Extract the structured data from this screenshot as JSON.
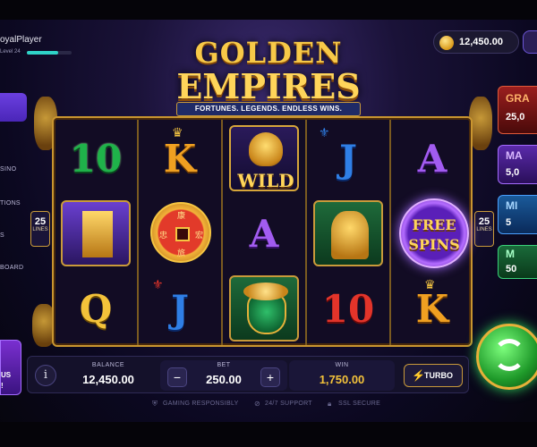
{
  "player": {
    "name": "oyalPlayer",
    "level": "Level 24",
    "xp_progress": 0.7
  },
  "balance_pill": {
    "amount": "12,450.00"
  },
  "sidebar": {
    "items": [
      {
        "label": "SINO",
        "icon": "casino-icon"
      },
      {
        "label": "TIONS",
        "icon": "promotions-icon"
      },
      {
        "label": "S",
        "icon": "tournaments-icon"
      },
      {
        "label": "BOARD",
        "icon": "leaderboard-icon"
      }
    ],
    "promo_line1": "US",
    "promo_line2": "!"
  },
  "game": {
    "title_line1": "GOLDEN",
    "title_line2": "EMPIRES",
    "tagline": "FORTUNES. LEGENDS. ENDLESS WINS.",
    "lines_count": "25",
    "lines_label": "LINES"
  },
  "reels": {
    "rows": [
      [
        "10",
        "K",
        "WILD",
        "J",
        "A"
      ],
      [
        "temple",
        "coin",
        "A",
        "lion",
        "FREE SPINS"
      ],
      [
        "Q",
        "J",
        "pot",
        "10",
        "K"
      ]
    ],
    "free_spins_line1": "FREE",
    "free_spins_line2": "SPINS",
    "wild_label": "WILD",
    "coin_glyphs": [
      "康",
      "忠",
      "宏",
      "旅"
    ]
  },
  "jackpots": [
    {
      "name": "GRA",
      "amount": "25,0",
      "color": "#9a1e1e"
    },
    {
      "name": "MA",
      "amount": "5,0",
      "color": "#5a2aaa"
    },
    {
      "name": "MI",
      "amount": "5",
      "color": "#1a5a9a"
    },
    {
      "name": "M",
      "amount": "50",
      "color": "#1a6a3a"
    }
  ],
  "controls": {
    "info_label": "i",
    "balance_label": "BALANCE",
    "balance_value": "12,450.00",
    "bet_label": "BET",
    "bet_value": "250.00",
    "bet_minus": "−",
    "bet_plus": "+",
    "win_label": "WIN",
    "win_value": "1,750.00",
    "turbo_label": "TURBO"
  },
  "footer": {
    "responsible": "GAMING RESPONSIBLY",
    "support": "24/7 SUPPORT",
    "secure": "SSL SECURE"
  },
  "colors": {
    "accent_gold": "#f3c23a",
    "spin_green": "#1f9a2a",
    "active_nav": "#6b3fe0"
  }
}
